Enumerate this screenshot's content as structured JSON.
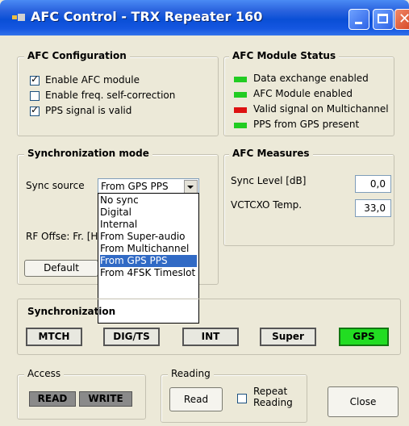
{
  "window": {
    "title": "AFC Control - TRX Repeater 160"
  },
  "afc_configuration": {
    "legend": "AFC Configuration",
    "items": [
      {
        "label": "Enable AFC module",
        "checked": true
      },
      {
        "label": "Enable freq. self-correction",
        "checked": false
      },
      {
        "label": "PPS signal is valid",
        "checked": true
      }
    ]
  },
  "afc_module_status": {
    "legend": "AFC Module Status",
    "items": [
      {
        "label": "Data exchange enabled",
        "color": "#22cc22"
      },
      {
        "label": "AFC Module enabled",
        "color": "#22cc22"
      },
      {
        "label": "Valid signal on Multichannel",
        "color": "#dd1111"
      },
      {
        "label": "PPS from GPS present",
        "color": "#22cc22"
      }
    ]
  },
  "sync_mode": {
    "legend": "Synchronization mode",
    "source_label": "Sync source",
    "selected": "From GPS PPS",
    "rf_offset_label": "RF Offse: Fr. [H",
    "default_button": "Default",
    "options": [
      "No sync",
      "Digital",
      "Internal",
      "From Super-audio",
      "From Multichannel",
      "From GPS PPS",
      "From 4FSK Timeslot"
    ],
    "selected_option_index": 5
  },
  "afc_measures": {
    "legend": "AFC Measures",
    "sync_level_label": "Sync Level [dB]",
    "sync_level_value": "0,0",
    "vctcxo_label": "VCTCXO Temp.",
    "vctcxo_value": "33,0"
  },
  "synchronization": {
    "legend": "Synchronization",
    "indicators": [
      {
        "label": "MTCH",
        "active": false
      },
      {
        "label": "DIG/TS",
        "active": false
      },
      {
        "label": "INT",
        "active": false
      },
      {
        "label": "Super",
        "active": false
      },
      {
        "label": "GPS",
        "active": true
      }
    ],
    "active_color": "#22dd22"
  },
  "access": {
    "legend": "Access",
    "read": "READ",
    "write": "WRITE"
  },
  "reading": {
    "legend": "Reading",
    "read_button": "Read",
    "repeat_label": "Repeat\nReading",
    "repeat_checked": false
  },
  "close_button": "Close"
}
